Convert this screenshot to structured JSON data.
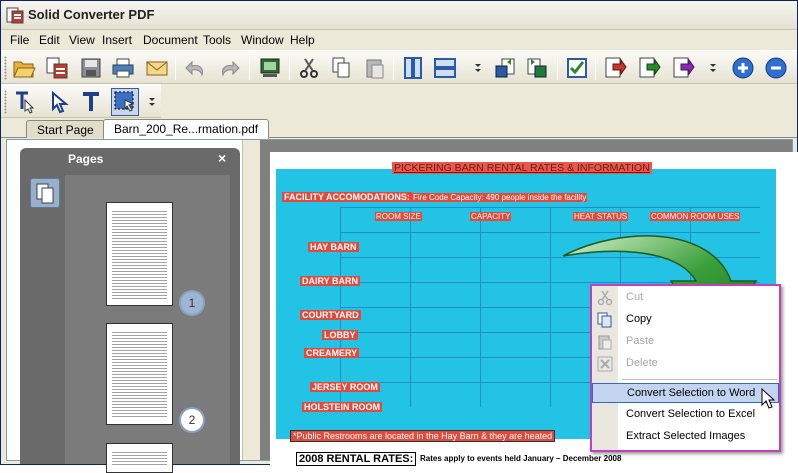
{
  "window": {
    "title": "Solid Converter PDF"
  },
  "menu": [
    "File",
    "Edit",
    "View",
    "Insert",
    "Document",
    "Tools",
    "Window",
    "Help"
  ],
  "toolbar": {
    "buttons": [
      "open-icon",
      "convert-icon",
      "save-icon",
      "print-icon",
      "email-icon",
      "undo-icon",
      "redo-icon",
      "capture-icon",
      "cut-icon",
      "copy-icon",
      "paste-icon",
      "single-page-icon",
      "continuous-page-icon",
      "convert-word-icon",
      "convert-excel-icon",
      "checklist-icon",
      "export-icon",
      "export-green-icon",
      "export-multi-icon",
      "zoom-in-icon",
      "zoom-out-icon"
    ]
  },
  "tools": [
    "text-select-icon",
    "select-arrow-icon",
    "text-tool-icon",
    "area-select-icon"
  ],
  "tabs": [
    {
      "label": "Start Page",
      "active": false
    },
    {
      "label": "Barn_200_Re...rmation.pdf",
      "active": true
    }
  ],
  "pages_panel": {
    "title": "Pages",
    "close": "×",
    "page_numbers": [
      "1",
      "2"
    ]
  },
  "document": {
    "title": "PICKERING BARN RENTAL RATES & INFORMATION",
    "facility_label": "FACILITY ACCOMODATIONS:",
    "capacity_note": "Fire Code Capacity: 490 people inside the facility",
    "columns": [
      "ROOM SIZE",
      "CAPACITY",
      "HEAT STATUS",
      "COMMON ROOM USES"
    ],
    "rows": [
      "HAY BARN",
      "DAIRY BARN",
      "COURTYARD",
      "LOBBY",
      "CREAMERY",
      "JERSEY ROOM",
      "HOLSTEIN ROOM"
    ],
    "footnote": "*Public Restrooms are located in the Hay Barn & they are heated",
    "rates_heading": "2008 RENTAL RATES:",
    "rates_note": "Rates apply to events held January – December 2008"
  },
  "context_menu": {
    "items": [
      {
        "label": "Cut",
        "icon": "cut-icon",
        "disabled": true
      },
      {
        "label": "Copy",
        "icon": "copy-icon",
        "disabled": false
      },
      {
        "label": "Paste",
        "icon": "paste-icon",
        "disabled": true
      },
      {
        "label": "Delete",
        "icon": "delete-icon",
        "disabled": true
      },
      {
        "label": "Convert Selection to Word",
        "icon": "",
        "disabled": false,
        "highlighted": true
      },
      {
        "label": "Convert Selection to Excel",
        "icon": "",
        "disabled": false
      },
      {
        "label": "Extract Selected Images",
        "icon": "",
        "disabled": false
      }
    ]
  },
  "colors": {
    "selection": "#23c3e6",
    "text_highlight": "#e24a3b",
    "menu_border": "#c040c0",
    "menu_highlight": "#c2d4ef",
    "arrow": "#2e8b2e"
  }
}
